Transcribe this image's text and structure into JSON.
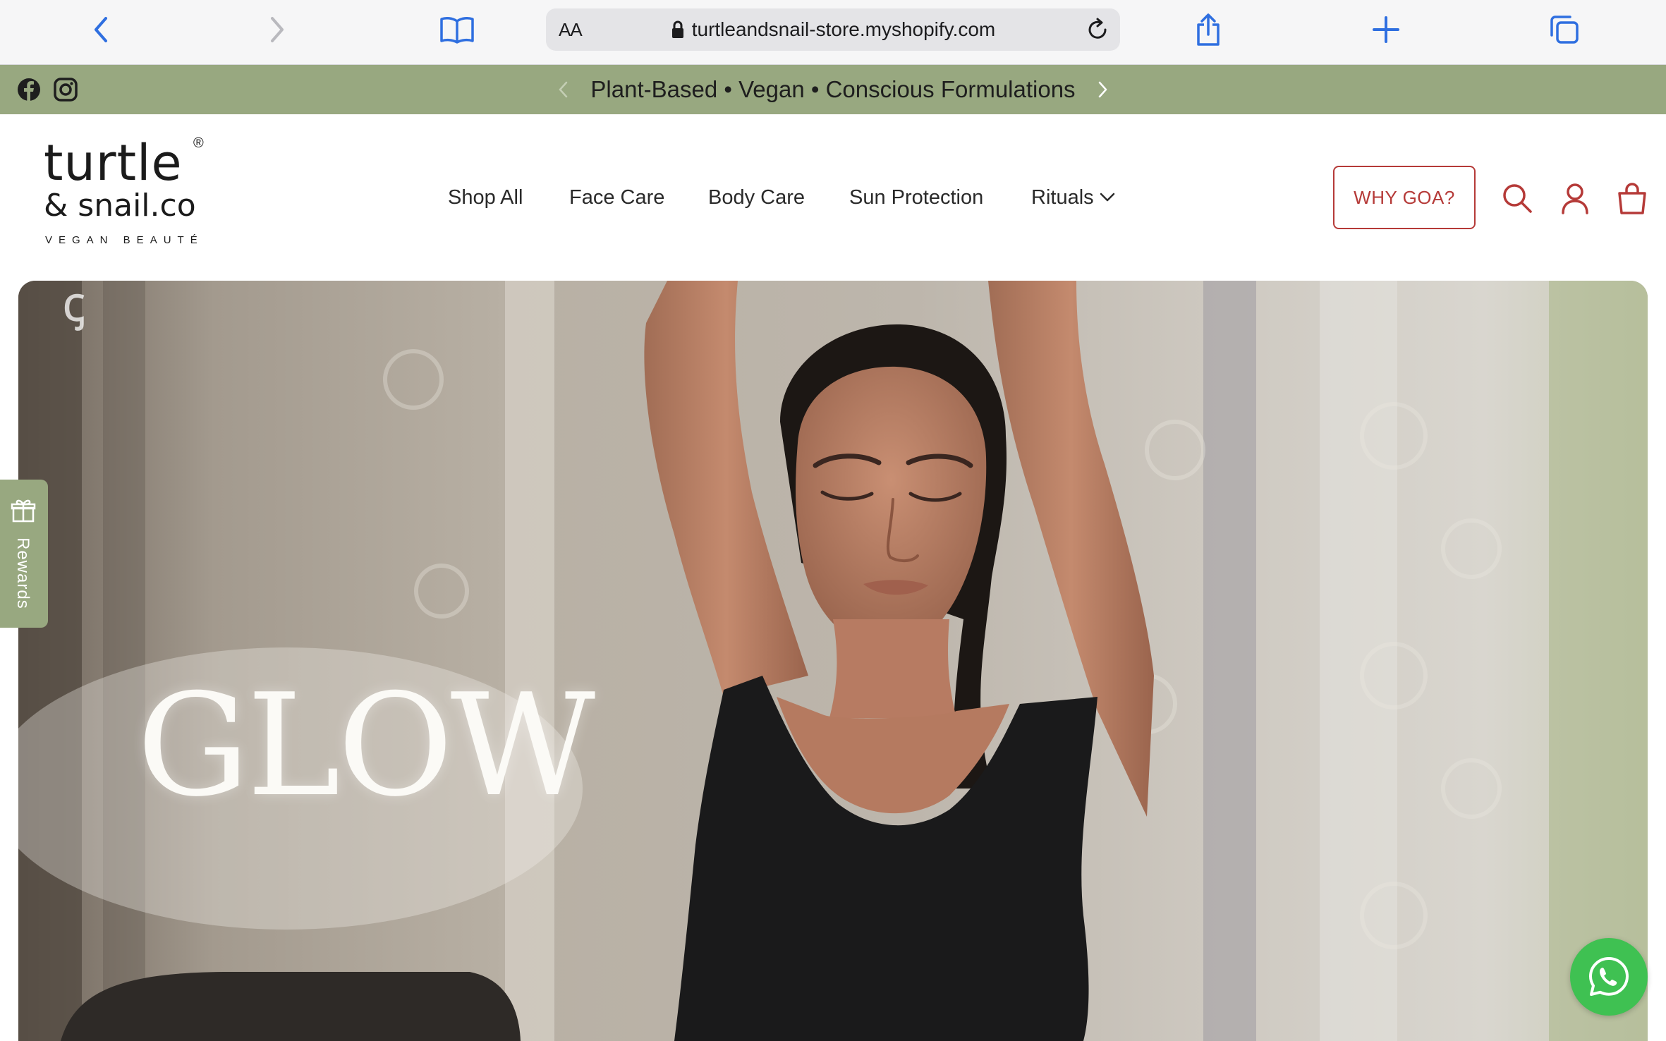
{
  "browser": {
    "url": "turtleandsnail-store.myshopify.com",
    "reader_label": "AA",
    "icons": [
      "back-icon",
      "forward-icon",
      "bookmarks-icon",
      "lock-icon",
      "reload-icon",
      "share-icon",
      "new-tab-icon",
      "tabs-icon"
    ]
  },
  "announcement": {
    "message": "Plant-Based • Vegan • Conscious Formulations",
    "social": [
      "facebook-icon",
      "instagram-icon"
    ],
    "bg_color": "#98a880"
  },
  "logo": {
    "line1": "turtle",
    "line2": "& snail.co",
    "tagline": "VEGAN BEAUTÉ",
    "registered": "®"
  },
  "nav": {
    "items": [
      {
        "label": "Shop All"
      },
      {
        "label": "Face Care"
      },
      {
        "label": "Body Care"
      },
      {
        "label": "Sun Protection"
      },
      {
        "label": "Rituals"
      }
    ]
  },
  "header": {
    "why_button": "WHY GOA?",
    "accent_color": "#b53a38",
    "icons": [
      "search-icon",
      "account-icon",
      "cart-icon"
    ]
  },
  "hero": {
    "headline": "GLOW",
    "watermark": "ꞔ"
  },
  "rewards": {
    "label": "Rewards"
  },
  "whatsapp": {
    "icon": "whatsapp-icon",
    "color": "#3fc152"
  }
}
